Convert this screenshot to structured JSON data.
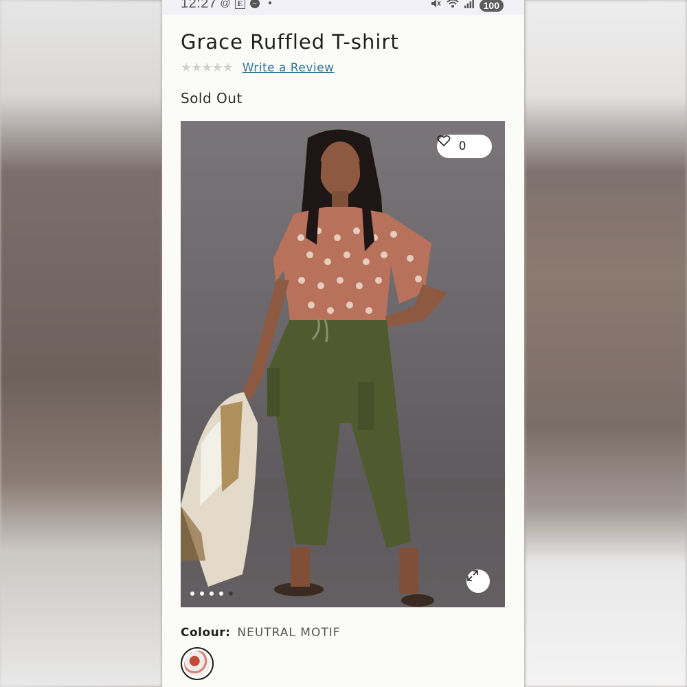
{
  "status": {
    "time": "12:27",
    "left_icons": [
      "threads-icon",
      "etsy-icon",
      "messenger-icon",
      "dot-icon"
    ],
    "battery": "100"
  },
  "product": {
    "title": "Grace Ruffled T-shirt",
    "stars": "★★★★★",
    "rating_filled": 0,
    "review_link": "Write a Review",
    "availability": "Sold Out",
    "like_count": "0",
    "colour_label": "Colour:",
    "colour_value": "NEUTRAL MOTIF"
  },
  "gallery": {
    "slides": 5,
    "active_slide": 5
  },
  "colors": {
    "link": "#2f7690",
    "page_bg": "#fbfbf7",
    "star_empty": "#cfcfcf"
  }
}
